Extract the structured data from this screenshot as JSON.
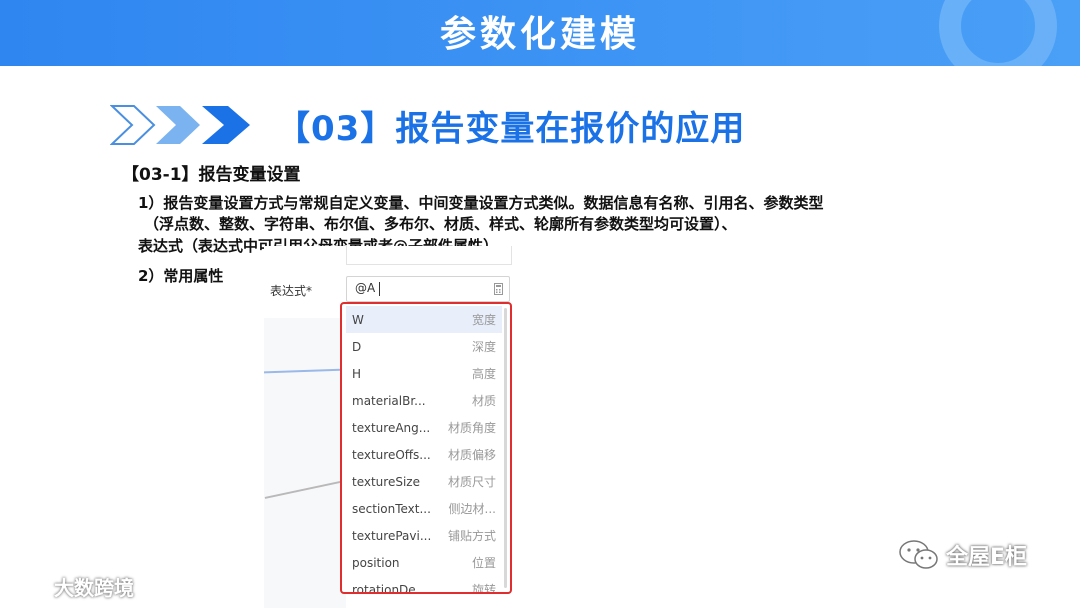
{
  "header": {
    "title": "参数化建模"
  },
  "heading": {
    "text": "【03】报告变量在报价的应用"
  },
  "sub_heading": "【03-1】报告变量设置",
  "paragraphs": {
    "p1": "1）报告变量设置方式与常规自定义变量、中间变量设置方式类似。数据信息有名称、引用名、参数类型",
    "p2": "（浮点数、整数、字符串、布尔值、多布尔、材质、样式、轮廓所有参数类型均可设置）、",
    "p3": "表达式（表达式中可引用父母变量或者@子部件属性）",
    "p4": "2）常用属性"
  },
  "expression": {
    "label": "表达式*",
    "value": "@A"
  },
  "dropdown": {
    "items": [
      {
        "name": "W",
        "alias": "宽度",
        "selected": true
      },
      {
        "name": "D",
        "alias": "深度"
      },
      {
        "name": "H",
        "alias": "高度"
      },
      {
        "name": "materialBr...",
        "alias": "材质"
      },
      {
        "name": "textureAng...",
        "alias": "材质角度"
      },
      {
        "name": "textureOffs...",
        "alias": "材质偏移"
      },
      {
        "name": "textureSize",
        "alias": "材质尺寸"
      },
      {
        "name": "sectionText...",
        "alias": "侧边材..."
      },
      {
        "name": "texturePavi...",
        "alias": "铺贴方式"
      },
      {
        "name": "position",
        "alias": "位置"
      },
      {
        "name": "rotationDe...",
        "alias": "旋转"
      }
    ]
  },
  "watermarks": {
    "left": "大数跨境",
    "right": "全屋E柜"
  },
  "colors": {
    "header_blue": "#2f86f0",
    "heading_blue": "#1a72e6",
    "highlight_red": "#e02d2d"
  }
}
